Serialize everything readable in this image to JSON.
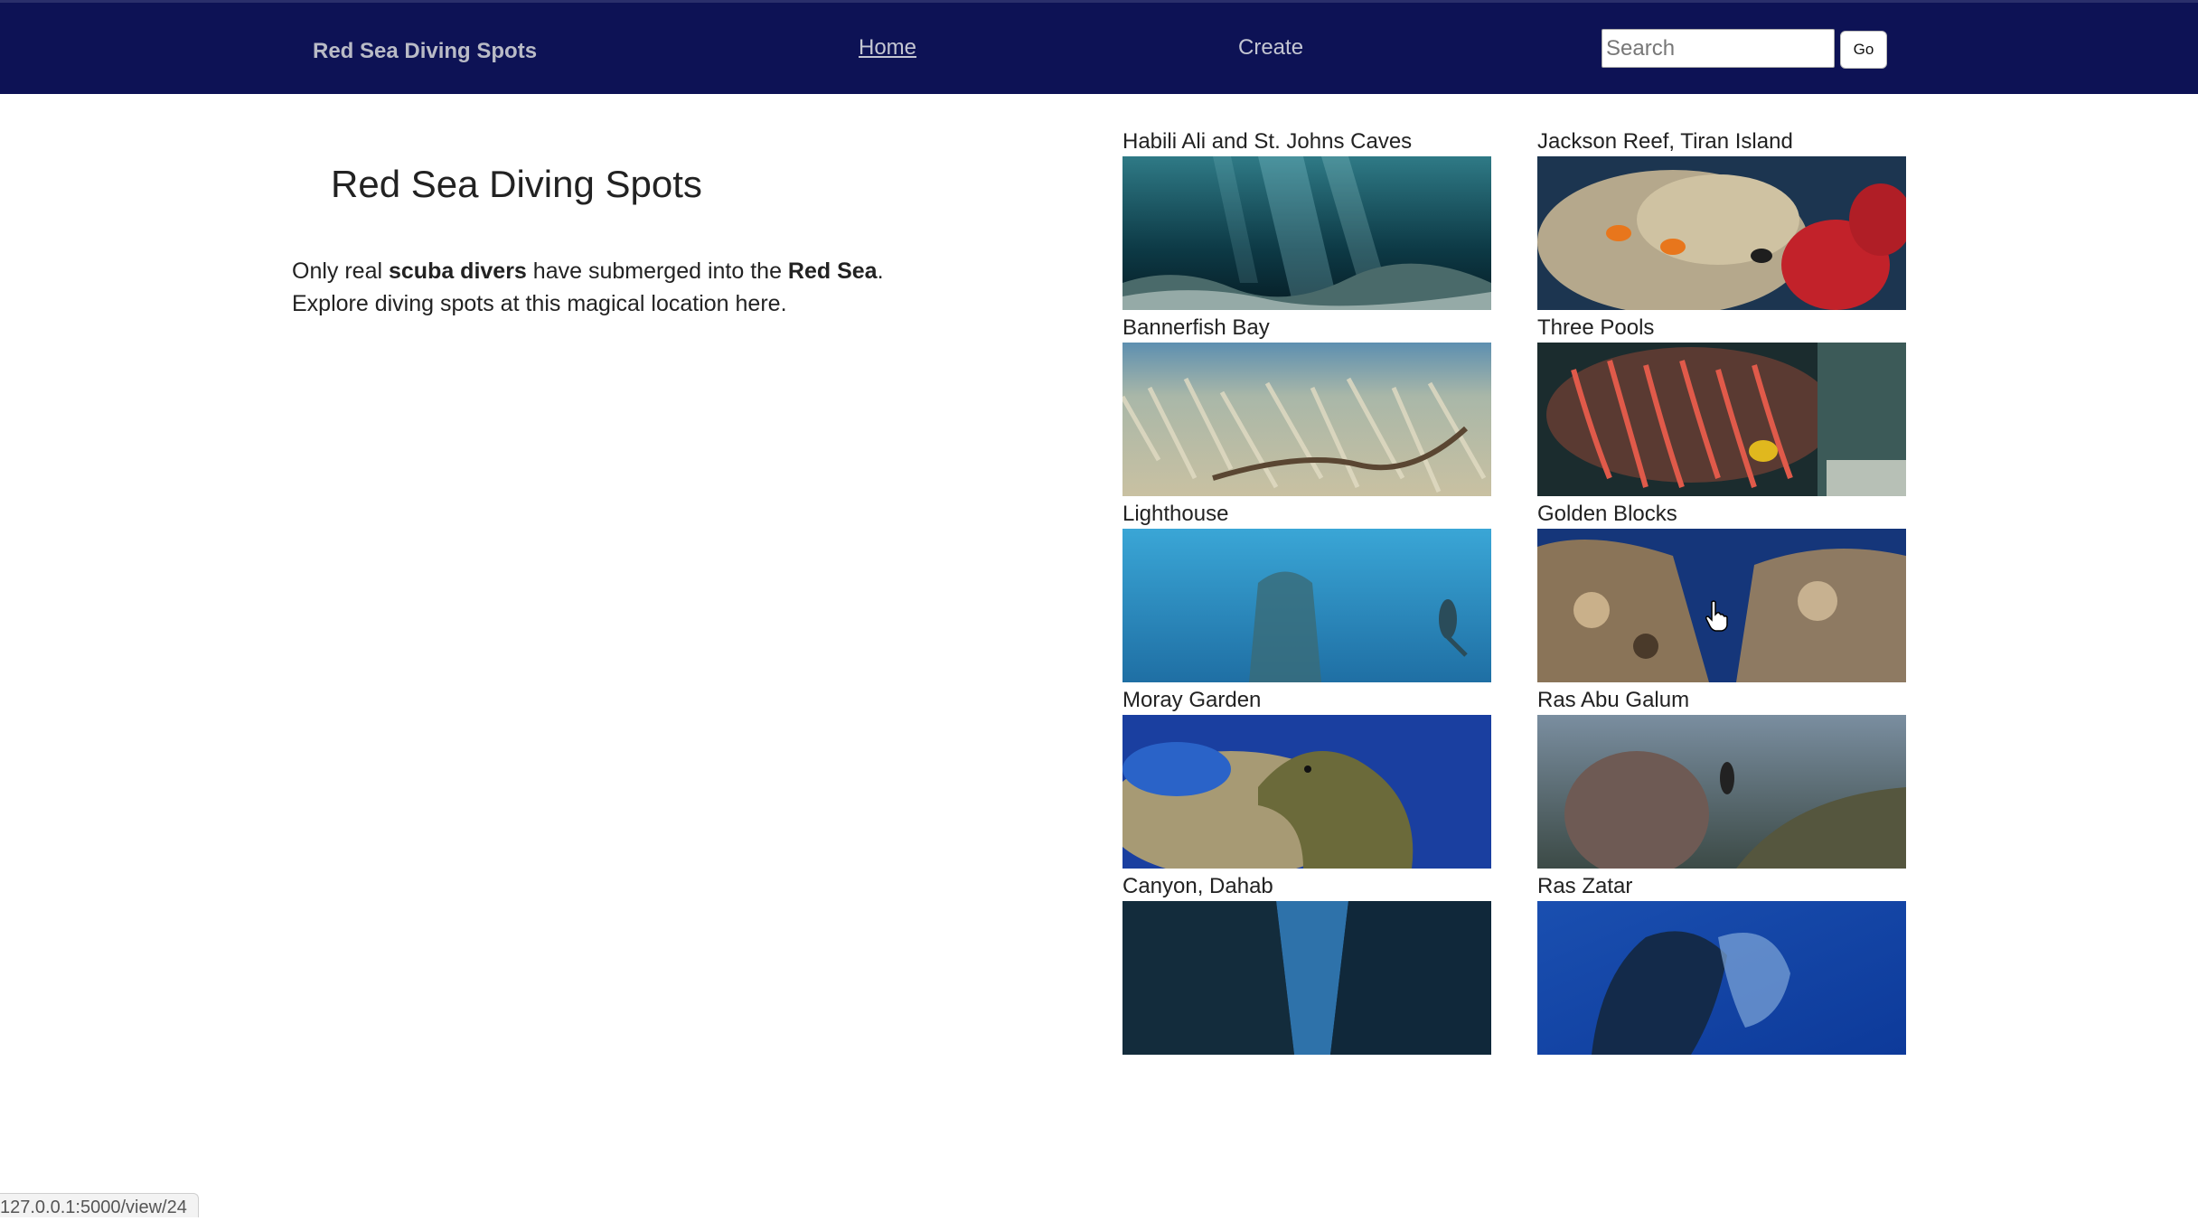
{
  "navbar": {
    "brand": "Red Sea Diving Spots",
    "home_label": "Home",
    "create_label": "Create",
    "search_placeholder": "Search",
    "go_label": "Go"
  },
  "hero": {
    "title": "Red Sea Diving Spots",
    "intro_1": "Only real ",
    "intro_bold_1": "scuba divers",
    "intro_2": " have submerged into the ",
    "intro_bold_2": "Red Sea",
    "intro_3": ".",
    "intro_line2": "Explore diving spots at this magical location here."
  },
  "spots": [
    {
      "name": "Habili Ali and St. Johns Caves"
    },
    {
      "name": "Jackson Reef, Tiran Island"
    },
    {
      "name": "Bannerfish Bay"
    },
    {
      "name": "Three Pools"
    },
    {
      "name": "Lighthouse"
    },
    {
      "name": "Golden Blocks"
    },
    {
      "name": "Moray Garden"
    },
    {
      "name": "Ras Abu Galum"
    },
    {
      "name": "Canyon, Dahab"
    },
    {
      "name": "Ras Zatar"
    }
  ],
  "status_bar": {
    "url": "127.0.0.1:5000/view/24"
  }
}
